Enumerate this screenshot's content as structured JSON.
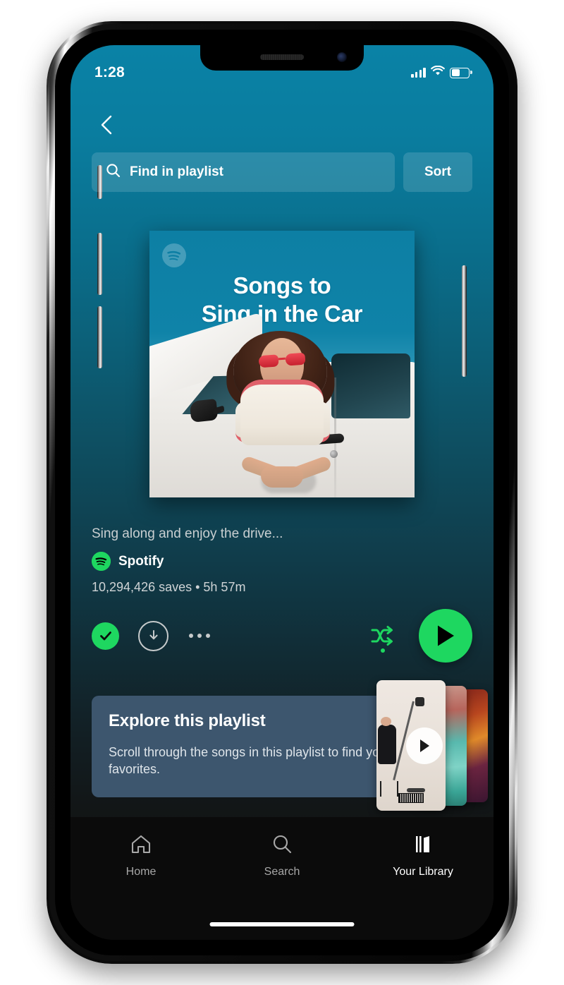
{
  "status_bar": {
    "time": "1:28",
    "signal_icon": "cellular-signal-icon",
    "wifi_icon": "wifi-icon",
    "battery_icon": "battery-icon"
  },
  "nav": {
    "back_icon": "chevron-left-icon"
  },
  "search": {
    "placeholder": "Find in playlist",
    "icon": "search-icon",
    "sort_label": "Sort"
  },
  "cover": {
    "title_line1": "Songs to",
    "title_line2": "Sing in the Car",
    "watermark_icon": "spotify-logo-icon",
    "alt": "Woman with curly hair and red sunglasses leaning out of a white car window"
  },
  "playlist": {
    "description": "Sing along and enjoy the drive...",
    "owner": "Spotify",
    "owner_icon": "spotify-logo-icon",
    "stats": "10,294,426 saves • 5h 57m"
  },
  "actions": {
    "saved_icon": "check-circle-icon",
    "download_icon": "download-circle-icon",
    "more_icon": "more-horizontal-icon",
    "shuffle_icon": "shuffle-icon",
    "play_icon": "play-icon"
  },
  "explore_card": {
    "title": "Explore this playlist",
    "body": "Scroll through the songs in this playlist to find your favorites.",
    "play_icon": "play-circle-icon"
  },
  "tabbar": {
    "items": [
      {
        "label": "Home",
        "icon": "home-icon",
        "active": false
      },
      {
        "label": "Search",
        "icon": "search-icon",
        "active": false
      },
      {
        "label": "Your Library",
        "icon": "library-icon",
        "active": true
      }
    ]
  },
  "colors": {
    "spotify_green": "#1ed760",
    "header_teal": "#0a82a6",
    "card_blue": "#3d566e",
    "app_background": "#121212"
  }
}
